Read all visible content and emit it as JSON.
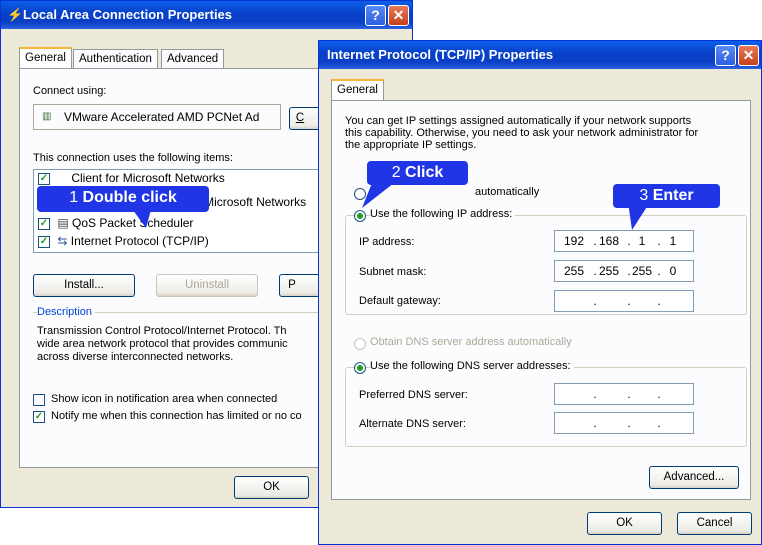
{
  "lac": {
    "title": "Local Area Connection Properties",
    "tabs": [
      "General",
      "Authentication",
      "Advanced"
    ],
    "connect_using_label": "Connect using:",
    "adapter_name": "VMware Accelerated AMD PCNet Ad",
    "configure_button": "C",
    "items_label": "This connection uses the following items:",
    "items": [
      {
        "label": "Client for Microsoft Networks",
        "checked": true
      },
      {
        "label": "File and Printer Sharing for Microsoft Networks",
        "checked": true
      },
      {
        "label": "QoS Packet Scheduler",
        "checked": true
      },
      {
        "label": "Internet Protocol (TCP/IP)",
        "checked": true
      }
    ],
    "install_button": "Install...",
    "uninstall_button": "Uninstall",
    "properties_button": "P",
    "description_label": "Description",
    "description_text": [
      "Transmission Control Protocol/Internet Protocol. Th",
      "wide area network protocol that provides communic",
      "across diverse interconnected networks."
    ],
    "show_icon_label": "Show icon in notification area when connected",
    "notify_label": "Notify me when this connection has limited or no co",
    "notify_checked": true,
    "ok_button": "OK"
  },
  "tcpip": {
    "title": "Internet Protocol (TCP/IP) Properties",
    "tab": "General",
    "intro": [
      "You can get IP settings assigned automatically if your network supports",
      "this capability. Otherwise, you need to ask your network administrator for",
      "the appropriate IP settings."
    ],
    "auto_ip_label": "automatically",
    "use_ip_label": "Use the following IP address:",
    "ip_address_label": "IP address:",
    "ip_address": [
      "192",
      "168",
      "1",
      "1"
    ],
    "subnet_label": "Subnet mask:",
    "subnet": [
      "255",
      "255",
      "255",
      "0"
    ],
    "gateway_label": "Default gateway:",
    "auto_dns_label": "Obtain DNS server address automatically",
    "use_dns_label": "Use the following DNS server addresses:",
    "preferred_dns_label": "Preferred DNS server:",
    "alternate_dns_label": "Alternate DNS server:",
    "advanced_button": "Advanced...",
    "ok_button": "OK",
    "cancel_button": "Cancel"
  },
  "callouts": {
    "c1": {
      "num": "1",
      "text": "Double click"
    },
    "c2": {
      "num": "2",
      "text": "Click"
    },
    "c3": {
      "num": "3",
      "text": "Enter"
    }
  },
  "colors": {
    "callout": "#1f35e6",
    "titlebar": "#0840c9",
    "dialog_bg": "#ece9d8"
  }
}
